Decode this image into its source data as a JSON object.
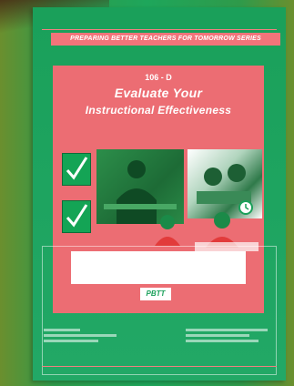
{
  "cover": {
    "series_title": "PREPARING BETTER TEACHERS FOR TOMORROW SERIES",
    "module_code": "106 - D",
    "title_line1": "Evaluate Your",
    "title_line2": "Instructional Effectiveness",
    "logo_text": "PBTT"
  },
  "colors": {
    "background_green": "#1ea65b",
    "panel_pink": "#ec6d73",
    "series_bar_pink": "#f2747a"
  },
  "icons": [
    "checkmark-icon",
    "checkmark-icon",
    "clock-icon"
  ]
}
